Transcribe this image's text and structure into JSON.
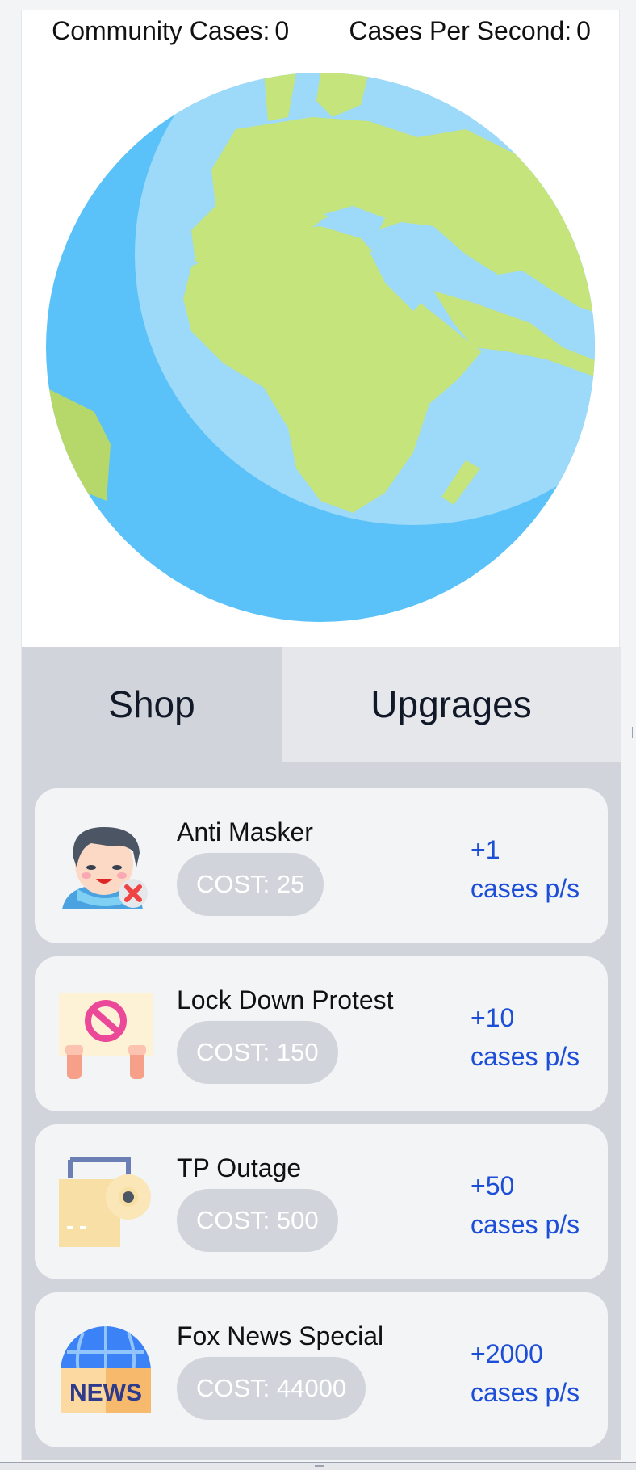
{
  "stats": {
    "community_label": "Community Cases:",
    "community_value": "0",
    "cps_label": "Cases Per Second:",
    "cps_value": "0"
  },
  "globe": {
    "icon": "earth-globe-icon"
  },
  "tabs": [
    {
      "label": "Shop",
      "active": true
    },
    {
      "label": "Upgrages",
      "active": false
    }
  ],
  "shop": {
    "items": [
      {
        "name": "Anti Masker",
        "cost": "COST: 25",
        "rate": "+1",
        "rate_unit": "cases p/s",
        "icon": "anti-masker-icon"
      },
      {
        "name": "Lock Down Protest",
        "cost": "COST: 150",
        "rate": "+10",
        "rate_unit": "cases p/s",
        "icon": "protest-sign-icon"
      },
      {
        "name": "TP Outage",
        "cost": "COST: 500",
        "rate": "+50",
        "rate_unit": "cases p/s",
        "icon": "toilet-paper-icon"
      },
      {
        "name": "Fox News Special",
        "cost": "COST: 44000",
        "rate": "+2000",
        "rate_unit": "cases p/s",
        "icon": "news-globe-icon",
        "icon_text": "NEWS"
      }
    ]
  },
  "colors": {
    "accent_blue": "#1d4ed8",
    "panel_gray": "#d1d5db",
    "card_bg": "#f3f4f6",
    "ocean": "#5ac2f8",
    "ocean_light": "#9dd9f9",
    "land": "#c5e47c"
  }
}
